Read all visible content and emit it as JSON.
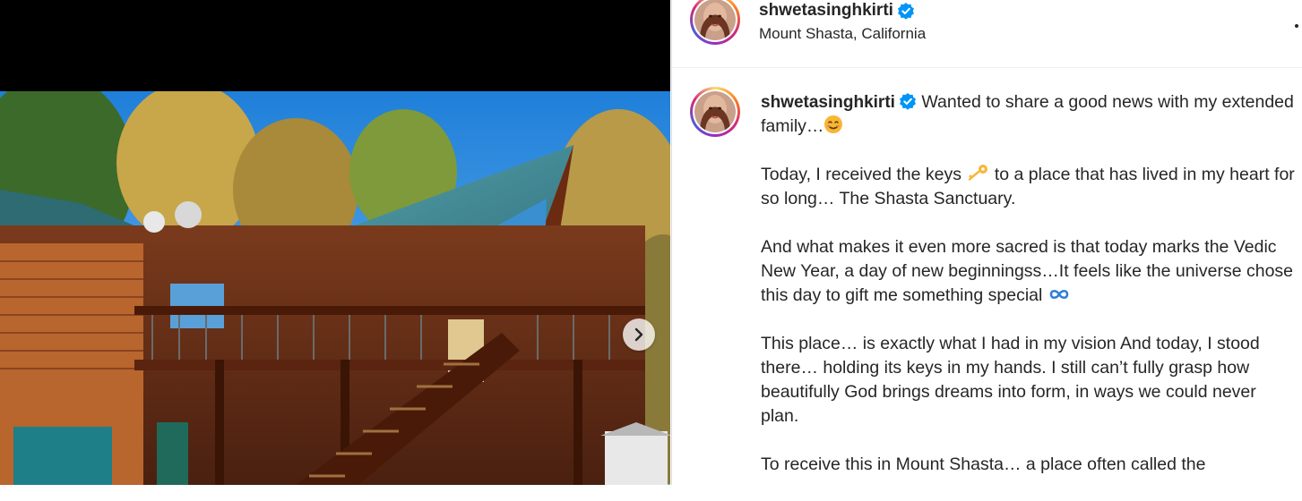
{
  "post": {
    "username": "shwetasinghkirti",
    "location": "Mount Shasta, California",
    "verified": true
  },
  "media": {
    "description_icon": "cabin-photo",
    "next_icon": "chevron-right-icon"
  },
  "caption": {
    "author": "shwetasinghkirti",
    "p1_text": "Wanted to share a good news with my extended family…",
    "p2_a": "Today, I received the keys",
    "p2_b": "to a place that has lived in my heart for so long… The Shasta Sanctuary.",
    "p3": "And what makes it even more sacred is that today marks the Vedic New Year, a day of new beginningss…It feels like the universe chose this day to gift me something special",
    "p4": "This place… is exactly what I had in my vision And today, I stood there… holding its keys in my hands. I still can’t fully grasp how beautifully God brings dreams into form, in ways we could never plan.",
    "p5": "To receive this in Mount Shasta… a place often called the"
  },
  "colors": {
    "verified_blue": "#0095f6",
    "text": "#262626"
  }
}
